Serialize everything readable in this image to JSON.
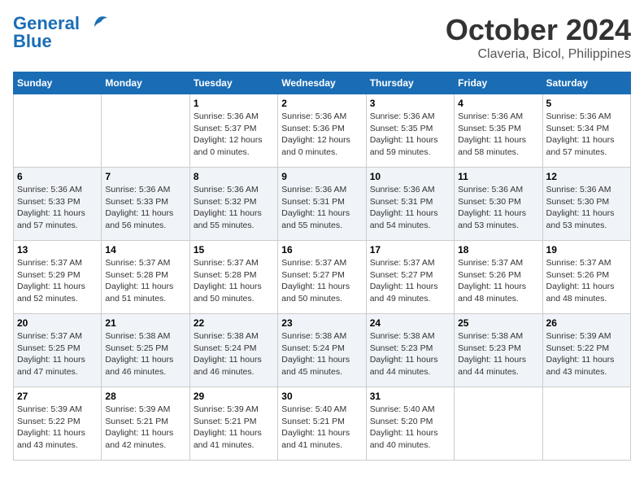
{
  "header": {
    "logo_line1": "General",
    "logo_line2": "Blue",
    "month": "October 2024",
    "location": "Claveria, Bicol, Philippines"
  },
  "weekdays": [
    "Sunday",
    "Monday",
    "Tuesday",
    "Wednesday",
    "Thursday",
    "Friday",
    "Saturday"
  ],
  "weeks": [
    [
      {
        "day": "",
        "detail": ""
      },
      {
        "day": "",
        "detail": ""
      },
      {
        "day": "1",
        "detail": "Sunrise: 5:36 AM\nSunset: 5:37 PM\nDaylight: 12 hours\nand 0 minutes."
      },
      {
        "day": "2",
        "detail": "Sunrise: 5:36 AM\nSunset: 5:36 PM\nDaylight: 12 hours\nand 0 minutes."
      },
      {
        "day": "3",
        "detail": "Sunrise: 5:36 AM\nSunset: 5:35 PM\nDaylight: 11 hours\nand 59 minutes."
      },
      {
        "day": "4",
        "detail": "Sunrise: 5:36 AM\nSunset: 5:35 PM\nDaylight: 11 hours\nand 58 minutes."
      },
      {
        "day": "5",
        "detail": "Sunrise: 5:36 AM\nSunset: 5:34 PM\nDaylight: 11 hours\nand 57 minutes."
      }
    ],
    [
      {
        "day": "6",
        "detail": "Sunrise: 5:36 AM\nSunset: 5:33 PM\nDaylight: 11 hours\nand 57 minutes."
      },
      {
        "day": "7",
        "detail": "Sunrise: 5:36 AM\nSunset: 5:33 PM\nDaylight: 11 hours\nand 56 minutes."
      },
      {
        "day": "8",
        "detail": "Sunrise: 5:36 AM\nSunset: 5:32 PM\nDaylight: 11 hours\nand 55 minutes."
      },
      {
        "day": "9",
        "detail": "Sunrise: 5:36 AM\nSunset: 5:31 PM\nDaylight: 11 hours\nand 55 minutes."
      },
      {
        "day": "10",
        "detail": "Sunrise: 5:36 AM\nSunset: 5:31 PM\nDaylight: 11 hours\nand 54 minutes."
      },
      {
        "day": "11",
        "detail": "Sunrise: 5:36 AM\nSunset: 5:30 PM\nDaylight: 11 hours\nand 53 minutes."
      },
      {
        "day": "12",
        "detail": "Sunrise: 5:36 AM\nSunset: 5:30 PM\nDaylight: 11 hours\nand 53 minutes."
      }
    ],
    [
      {
        "day": "13",
        "detail": "Sunrise: 5:37 AM\nSunset: 5:29 PM\nDaylight: 11 hours\nand 52 minutes."
      },
      {
        "day": "14",
        "detail": "Sunrise: 5:37 AM\nSunset: 5:28 PM\nDaylight: 11 hours\nand 51 minutes."
      },
      {
        "day": "15",
        "detail": "Sunrise: 5:37 AM\nSunset: 5:28 PM\nDaylight: 11 hours\nand 50 minutes."
      },
      {
        "day": "16",
        "detail": "Sunrise: 5:37 AM\nSunset: 5:27 PM\nDaylight: 11 hours\nand 50 minutes."
      },
      {
        "day": "17",
        "detail": "Sunrise: 5:37 AM\nSunset: 5:27 PM\nDaylight: 11 hours\nand 49 minutes."
      },
      {
        "day": "18",
        "detail": "Sunrise: 5:37 AM\nSunset: 5:26 PM\nDaylight: 11 hours\nand 48 minutes."
      },
      {
        "day": "19",
        "detail": "Sunrise: 5:37 AM\nSunset: 5:26 PM\nDaylight: 11 hours\nand 48 minutes."
      }
    ],
    [
      {
        "day": "20",
        "detail": "Sunrise: 5:37 AM\nSunset: 5:25 PM\nDaylight: 11 hours\nand 47 minutes."
      },
      {
        "day": "21",
        "detail": "Sunrise: 5:38 AM\nSunset: 5:25 PM\nDaylight: 11 hours\nand 46 minutes."
      },
      {
        "day": "22",
        "detail": "Sunrise: 5:38 AM\nSunset: 5:24 PM\nDaylight: 11 hours\nand 46 minutes."
      },
      {
        "day": "23",
        "detail": "Sunrise: 5:38 AM\nSunset: 5:24 PM\nDaylight: 11 hours\nand 45 minutes."
      },
      {
        "day": "24",
        "detail": "Sunrise: 5:38 AM\nSunset: 5:23 PM\nDaylight: 11 hours\nand 44 minutes."
      },
      {
        "day": "25",
        "detail": "Sunrise: 5:38 AM\nSunset: 5:23 PM\nDaylight: 11 hours\nand 44 minutes."
      },
      {
        "day": "26",
        "detail": "Sunrise: 5:39 AM\nSunset: 5:22 PM\nDaylight: 11 hours\nand 43 minutes."
      }
    ],
    [
      {
        "day": "27",
        "detail": "Sunrise: 5:39 AM\nSunset: 5:22 PM\nDaylight: 11 hours\nand 43 minutes."
      },
      {
        "day": "28",
        "detail": "Sunrise: 5:39 AM\nSunset: 5:21 PM\nDaylight: 11 hours\nand 42 minutes."
      },
      {
        "day": "29",
        "detail": "Sunrise: 5:39 AM\nSunset: 5:21 PM\nDaylight: 11 hours\nand 41 minutes."
      },
      {
        "day": "30",
        "detail": "Sunrise: 5:40 AM\nSunset: 5:21 PM\nDaylight: 11 hours\nand 41 minutes."
      },
      {
        "day": "31",
        "detail": "Sunrise: 5:40 AM\nSunset: 5:20 PM\nDaylight: 11 hours\nand 40 minutes."
      },
      {
        "day": "",
        "detail": ""
      },
      {
        "day": "",
        "detail": ""
      }
    ]
  ]
}
